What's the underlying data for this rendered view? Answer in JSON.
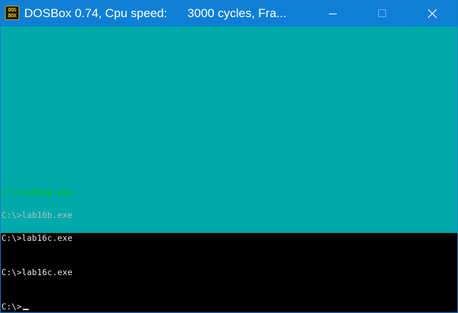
{
  "window": {
    "title": "DOSBox 0.74, Cpu speed:      3000 cycles, Fra...",
    "icon_lines": [
      "DOS",
      "BOX"
    ],
    "icon": "dosbox-icon",
    "controls": [
      "minimize-icon",
      "maximize-icon",
      "close-icon"
    ]
  },
  "colors": {
    "titlebar": "#0f7fd6",
    "screen_bg_top": "#00aaaa",
    "screen_bg_bottom": "#000000",
    "line_green": "#00cc00",
    "line_gray": "#bcbcbc",
    "line_white": "#e6e6e6"
  },
  "console": {
    "lines": [
      "C:\\>lab16a.exe",
      "C:\\>lab16b.exe",
      "C:\\>lab16c.exe",
      "C:\\>lab16c.exe"
    ],
    "prompt": "C:\\>"
  }
}
